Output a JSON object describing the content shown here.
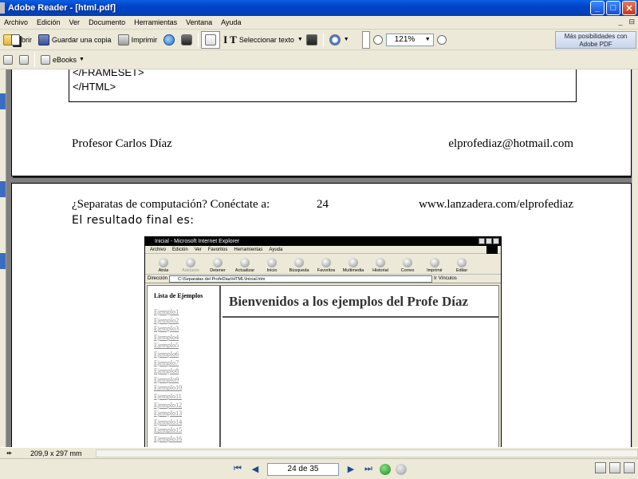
{
  "window": {
    "title": "Adobe Reader - [html.pdf]",
    "buttons": [
      "_",
      "□",
      "✕"
    ]
  },
  "menubar": {
    "items": [
      "Archivo",
      "Edición",
      "Ver",
      "Documento",
      "Herramientas",
      "Ventana",
      "Ayuda"
    ],
    "right_controls": [
      "_",
      "⊟"
    ]
  },
  "toolbar1": {
    "open_label": "Abrir",
    "save_label": "Guardar una copia",
    "print_label": "Imprimir",
    "select_text_label": "Seleccionar texto",
    "zoom_value": "121%",
    "promo_text": "Más posibilidades con Adobe PDF"
  },
  "toolbar2": {
    "ebooks_label": "eBooks"
  },
  "page1": {
    "code_lines": [
      "</FRAMESET>",
      "</HTML>"
    ],
    "author": "Profesor Carlos Díaz",
    "email": "elprofediaz@hotmail.com"
  },
  "page2": {
    "header_left": "¿Separatas de computación? Conéctate a:",
    "page_number": "24",
    "header_right": "www.lanzadera.com/elprofediaz",
    "result_label": "El resultado final es:"
  },
  "ie": {
    "title": "Inicial - Microsoft Internet Explorer",
    "menu": [
      "Archivo",
      "Edición",
      "Ver",
      "Favoritos",
      "Herramientas",
      "Ayuda"
    ],
    "tools": [
      "Atrás",
      "Adelante",
      "Detener",
      "Actualizar",
      "Inicio",
      "Búsqueda",
      "Favoritos",
      "Multimedia",
      "Historial",
      "Correo",
      "Imprimir",
      "Editar"
    ],
    "address_label": "Dirección",
    "address_value": "C:\\Separatas del ProfeDiaz\\HTML\\Inicial.htm",
    "links_label": "Vínculos",
    "go_label": "Ir",
    "sidebar_title": "Lista de Ejemplos",
    "links": [
      "Ejemplo1",
      "Ejemplo2",
      "Ejemplo3",
      "Ejemplo4",
      "Ejemplo5",
      "Ejemplo6",
      "Ejemplo7",
      "Ejemplo8",
      "Ejemplo9",
      "Ejemplo10",
      "Ejemplo11",
      "Ejemplo12",
      "Ejemplo13",
      "Ejemplo14",
      "Ejemplo15",
      "Ejemplo16"
    ],
    "heading": "Bienvenidos a los ejemplos del Profe Díaz"
  },
  "status": {
    "page_size": "209,9 x 297 mm"
  },
  "nav": {
    "page_field": "24 de 35"
  }
}
